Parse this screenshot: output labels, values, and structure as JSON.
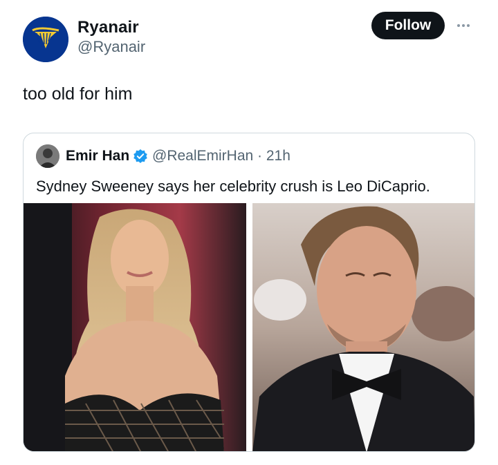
{
  "post": {
    "author": {
      "name": "Ryanair",
      "handle": "@Ryanair",
      "avatar_icon": "ryanair-harp-logo-icon",
      "avatar_color": "#073590"
    },
    "follow_label": "Follow",
    "more_icon": "more-options-icon",
    "text": "too old for him"
  },
  "quote": {
    "author": {
      "name": "Emir Han",
      "handle_time": "@RealEmirHan · 21h",
      "verified_icon": "verified-badge-icon",
      "verified_color": "#1d9bf0"
    },
    "text": "Sydney Sweeney says her celebrity crush is Leo DiCaprio.",
    "media": [
      {
        "alt": "photo-woman-blonde-red-carpet"
      },
      {
        "alt": "photo-man-tuxedo-bowtie"
      }
    ]
  },
  "colors": {
    "text_primary": "#0f1419",
    "text_secondary": "#536471",
    "border": "#cfd9de",
    "follow_bg": "#0f1419"
  }
}
